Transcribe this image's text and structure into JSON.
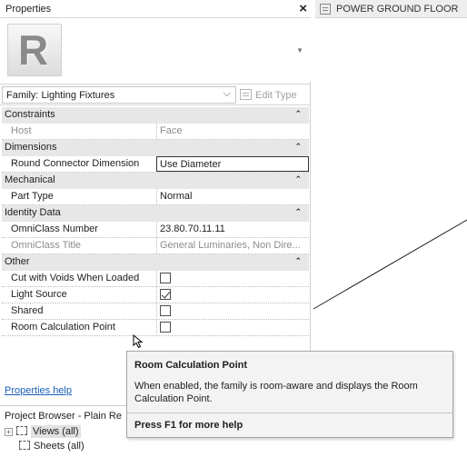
{
  "properties": {
    "title": "Properties",
    "close_label": "×",
    "type_preview_letter": "R",
    "family_selector": "Family: Lighting Fixtures",
    "edit_type_label": "Edit Type",
    "rows": [
      {
        "kind": "category",
        "label": "Constraints"
      },
      {
        "kind": "property",
        "name": "Host",
        "value": "Face",
        "readonly": true
      },
      {
        "kind": "category",
        "label": "Dimensions"
      },
      {
        "kind": "property",
        "name": "Round Connector Dimension",
        "value": "Use Diameter",
        "editing": true
      },
      {
        "kind": "category",
        "label": "Mechanical"
      },
      {
        "kind": "property",
        "name": "Part Type",
        "value": "Normal"
      },
      {
        "kind": "category",
        "label": "Identity Data"
      },
      {
        "kind": "property",
        "name": "OmniClass Number",
        "value": "23.80.70.11.11"
      },
      {
        "kind": "property",
        "name": "OmniClass Title",
        "value": "General Luminaries, Non Dire...",
        "readonly": true
      },
      {
        "kind": "category",
        "label": "Other"
      },
      {
        "kind": "checkbox",
        "name": "Cut with Voids When Loaded",
        "checked": false
      },
      {
        "kind": "checkbox",
        "name": "Light Source",
        "checked": true
      },
      {
        "kind": "checkbox",
        "name": "Shared",
        "checked": false
      },
      {
        "kind": "checkbox",
        "name": "Room Calculation Point",
        "checked": false
      }
    ],
    "help_link": "Properties help"
  },
  "project_browser": {
    "title": "Project Browser - Plain Re",
    "items": [
      {
        "label": "Views (all)",
        "expand": "+"
      },
      {
        "label": "Sheets (all)",
        "expand": ""
      }
    ]
  },
  "view_tab": {
    "title": "POWER GROUND FLOOR"
  },
  "tooltip": {
    "title": "Room Calculation Point",
    "description": "When enabled, the family is room-aware and displays the Room Calculation Point.",
    "help": "Press F1 for more help"
  },
  "icons": {
    "close": "close-icon",
    "collapse": "chevron-up-icon",
    "dropdown": "chevron-down-icon",
    "edit_type": "edit-type-icon",
    "view": "floor-plan-icon"
  }
}
